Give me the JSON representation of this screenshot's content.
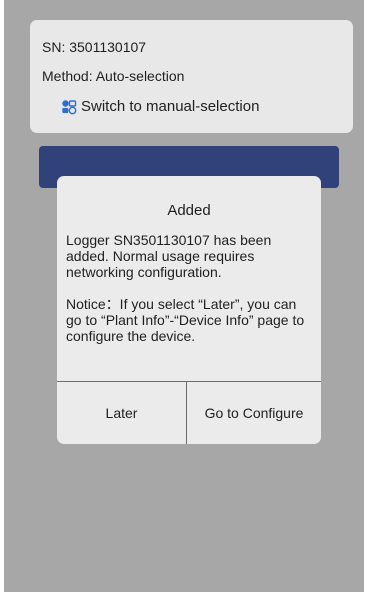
{
  "device_info": {
    "sn": "SN: 3501130107",
    "method": "Method: Auto-selection",
    "switch_label": "Switch to manual-selection",
    "switch_icon": "switch-icon"
  },
  "dialog": {
    "title": "Added",
    "message": "Logger SN3501130107 has been added. Normal usage requires networking configuration.",
    "notice": "Notice：If you select “Later”, you can go to “Plant Info”-“Device Info” page to configure the device.",
    "later_label": "Later",
    "configure_label": "Go to Configure"
  },
  "colors": {
    "overlay": "#a7a7a7",
    "card": "#e8e8e8",
    "primary_bar": "#31427b",
    "dialog_bg": "#ebebeb",
    "icon_blue": "#2b6fd6"
  }
}
